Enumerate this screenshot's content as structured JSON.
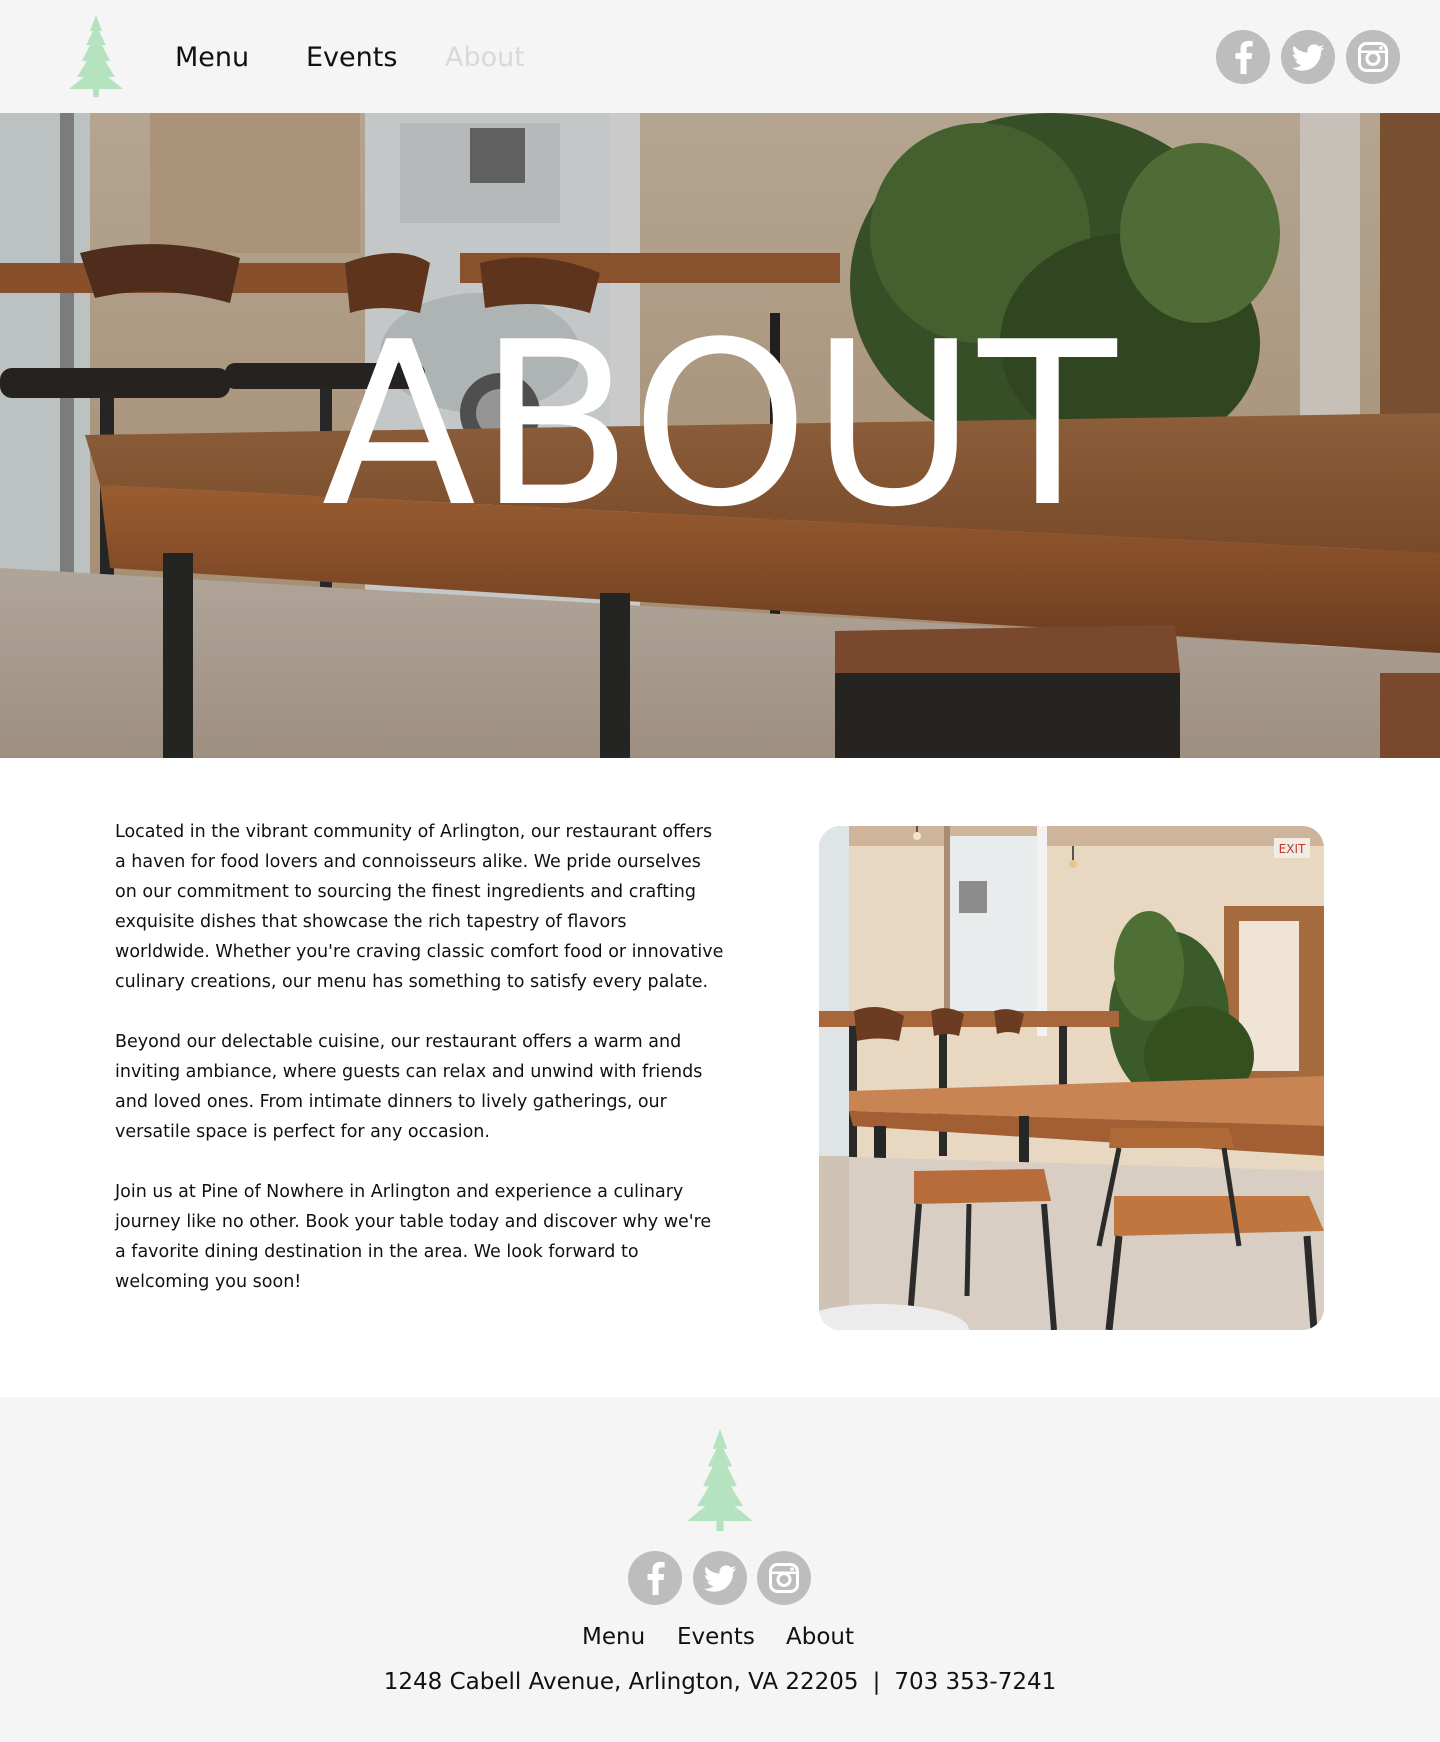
{
  "header": {
    "logo_icon": "pine-tree-icon",
    "nav": [
      {
        "label": "Menu",
        "active": false
      },
      {
        "label": "Events",
        "active": false
      },
      {
        "label": "About",
        "active": true
      }
    ],
    "social": [
      "facebook-icon",
      "twitter-icon",
      "instagram-icon"
    ]
  },
  "hero": {
    "title": "ABOUT"
  },
  "content": {
    "paragraphs": [
      "Located in the vibrant community of Arlington, our restaurant offers a haven for food lovers and connoisseurs alike. We pride ourselves on our commitment to sourcing the finest ingredients and crafting exquisite dishes that showcase the rich tapestry of flavors worldwide. Whether you're craving classic comfort food or innovative culinary creations, our menu has something to satisfy every palate.",
      "Beyond our delectable cuisine, our restaurant offers a warm and inviting ambiance, where guests can relax and unwind with friends and loved ones. From intimate dinners to lively gatherings, our versatile space is perfect for any occasion.",
      "Join us at Pine of Nowhere in Arlington and experience a culinary journey like no other. Book your table today and discover why we're a favorite dining destination in the area. We look forward to welcoming you soon!"
    ],
    "photo_sign": "EXIT"
  },
  "footer": {
    "logo_icon": "pine-tree-icon",
    "social": [
      "facebook-icon",
      "twitter-icon",
      "instagram-icon"
    ],
    "nav": [
      "Menu",
      "Events",
      "About"
    ],
    "address": "1248 Cabell Avenue, Arlington, VA 22205",
    "separator": "|",
    "phone": "703 353-7241"
  },
  "colors": {
    "header_bg": "#f5f5f5",
    "logo_green": "#b5e3c0",
    "social_gray": "#bdbdbd",
    "nav_active": "#d9d9d9",
    "text": "#111111"
  }
}
